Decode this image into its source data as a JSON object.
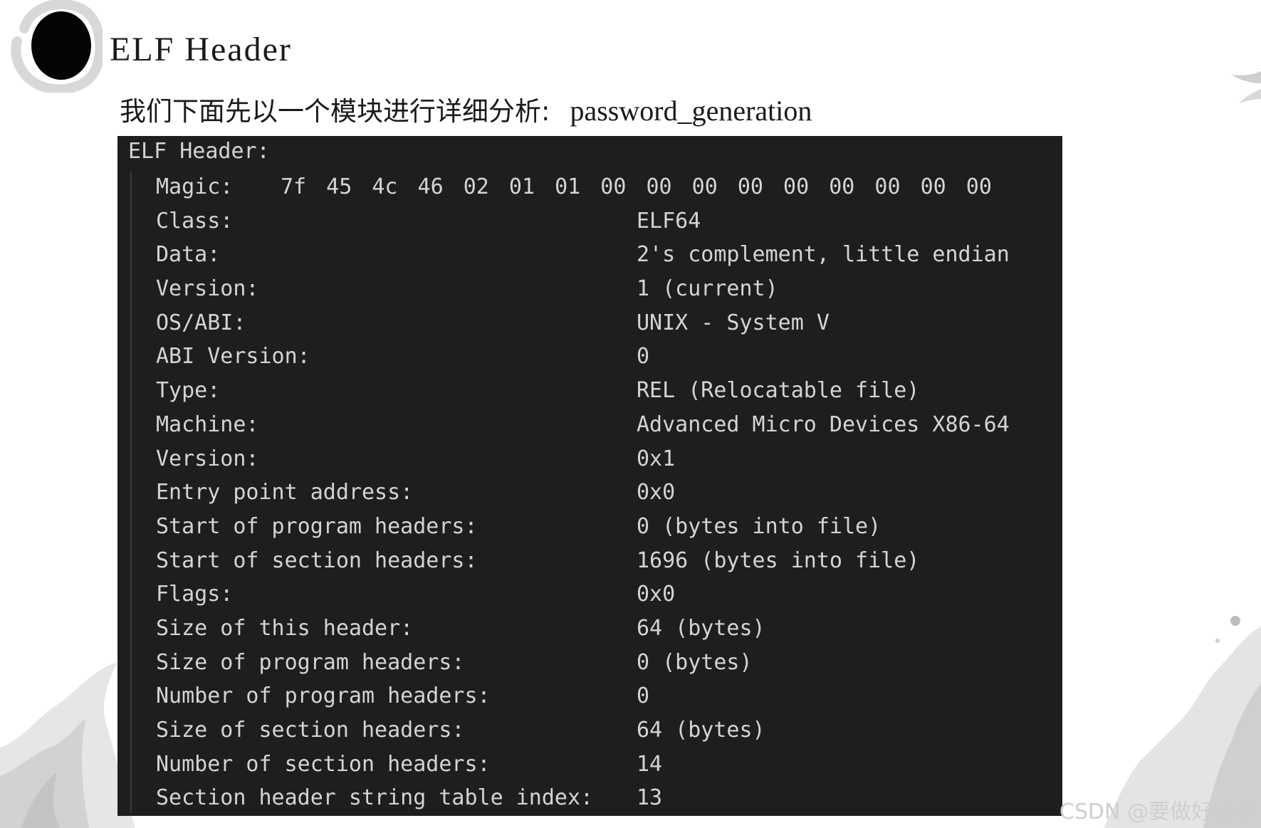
{
  "slide": {
    "title": "ELF Header",
    "subtitle_cn": "我们下面先以一个模块进行详细分析:",
    "subtitle_module": "password_generation",
    "watermark": "CSDN @要做好青年"
  },
  "terminal": {
    "header": "ELF Header:",
    "magic_label": "Magic:",
    "magic_bytes": "7f 45 4c 46 02 01 01 00 00 00 00 00 00 00 00 00",
    "rows": [
      {
        "key": "Class:",
        "value": "ELF64"
      },
      {
        "key": "Data:",
        "value": "2's complement, little endian"
      },
      {
        "key": "Version:",
        "value": "1 (current)"
      },
      {
        "key": "OS/ABI:",
        "value": "UNIX - System V"
      },
      {
        "key": "ABI Version:",
        "value": "0"
      },
      {
        "key": "Type:",
        "value": "REL (Relocatable file)"
      },
      {
        "key": "Machine:",
        "value": "Advanced Micro Devices X86-64"
      },
      {
        "key": "Version:",
        "value": "0x1"
      },
      {
        "key": "Entry point address:",
        "value": "0x0"
      },
      {
        "key": "Start of program headers:",
        "value": "0 (bytes into file)"
      },
      {
        "key": "Start of section headers:",
        "value": "1696 (bytes into file)"
      },
      {
        "key": "Flags:",
        "value": "0x0"
      },
      {
        "key": "Size of this header:",
        "value": "64 (bytes)"
      },
      {
        "key": "Size of program headers:",
        "value": "0 (bytes)"
      },
      {
        "key": "Number of program headers:",
        "value": "0"
      },
      {
        "key": "Size of section headers:",
        "value": "64 (bytes)"
      },
      {
        "key": "Number of section headers:",
        "value": "14"
      },
      {
        "key": "Section header string table index:",
        "value": "13"
      }
    ]
  },
  "colors": {
    "terminal_bg": "#1e1e1e",
    "terminal_text": "#d4d4d4",
    "page_bg": "#ffffff"
  }
}
